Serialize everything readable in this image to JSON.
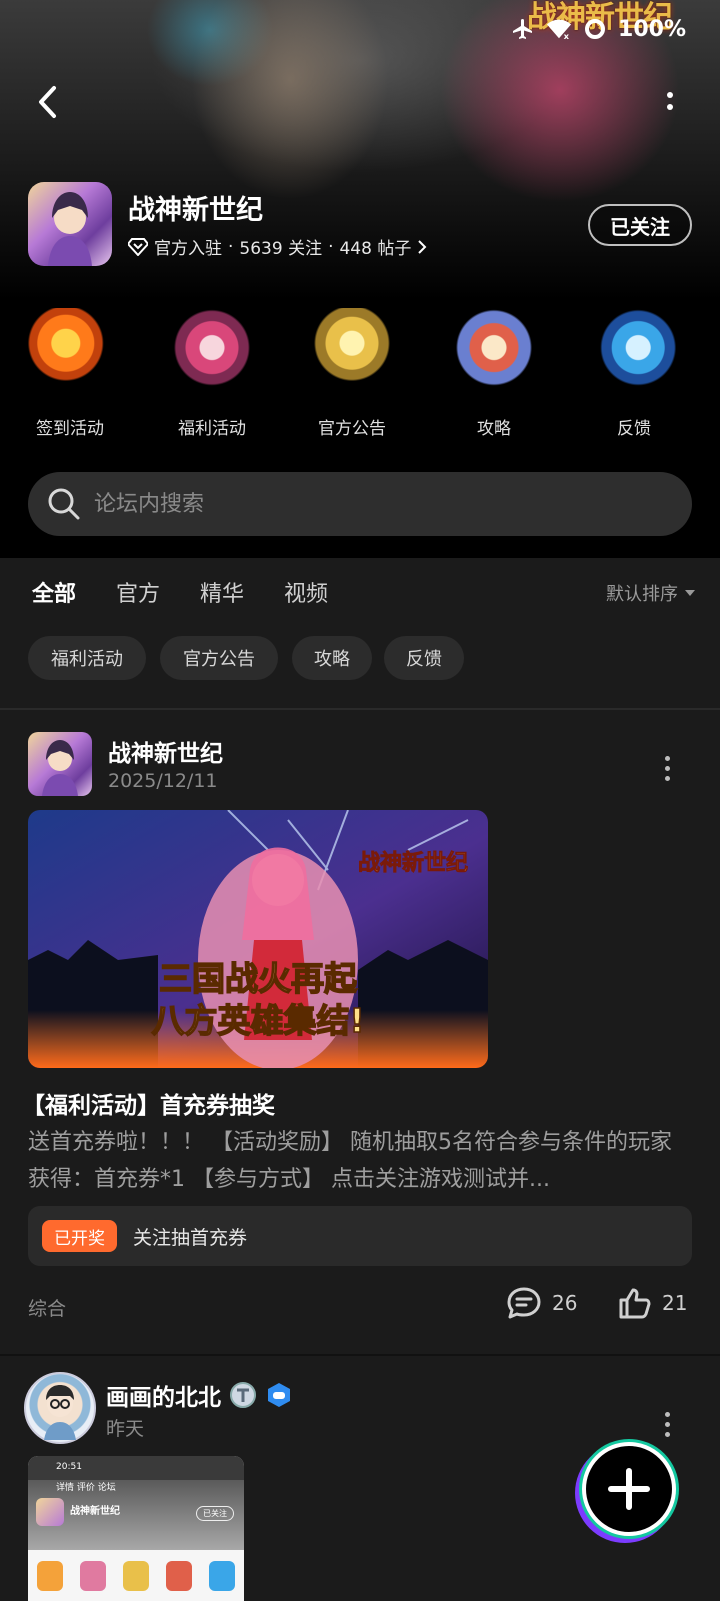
{
  "status_bar": {
    "battery": "100%"
  },
  "hero": {
    "logo_text": "战神新世纪"
  },
  "game": {
    "name": "战神新世纪",
    "official": "官方入驻",
    "follows": "5639 关注",
    "posts": "448 帖子",
    "follow_button": "已关注"
  },
  "quick_entries": [
    {
      "label": "签到活动"
    },
    {
      "label": "福利活动"
    },
    {
      "label": "官方公告"
    },
    {
      "label": "攻略"
    },
    {
      "label": "反馈"
    }
  ],
  "search": {
    "placeholder": "论坛内搜索"
  },
  "tabs": [
    {
      "label": "全部"
    },
    {
      "label": "官方"
    },
    {
      "label": "精华"
    },
    {
      "label": "视频"
    }
  ],
  "sort_label": "默认排序",
  "chips": [
    {
      "label": "福利活动"
    },
    {
      "label": "官方公告"
    },
    {
      "label": "攻略"
    },
    {
      "label": "反馈"
    }
  ],
  "post1": {
    "author": "战神新世纪",
    "date": "2025/12/11",
    "image_line1": "三国战火再起",
    "image_line2": "八方英雄集结!",
    "image_logo": "战神新世纪",
    "title": "【福利活动】首充券抽奖",
    "body": "送首充券啦！！！ 【活动奖励】 随机抽取5名符合参与条件的玩家获得：首充券*1 【参与方式】 点击关注游戏测试并...",
    "lottery_badge": "已开奖",
    "lottery_text": "关注抽首充券",
    "category": "综合",
    "comments": "26",
    "likes": "21"
  },
  "post2": {
    "author": "画画的北北",
    "date": "昨天",
    "thumb": {
      "time": "20:51",
      "tabs": "详情  评价  论坛",
      "title": "战神新世纪",
      "button": "已关注"
    }
  },
  "colors": {
    "accent": "#17c8a0",
    "badge": "#ff6a2e",
    "background": "#1b1b1b"
  }
}
